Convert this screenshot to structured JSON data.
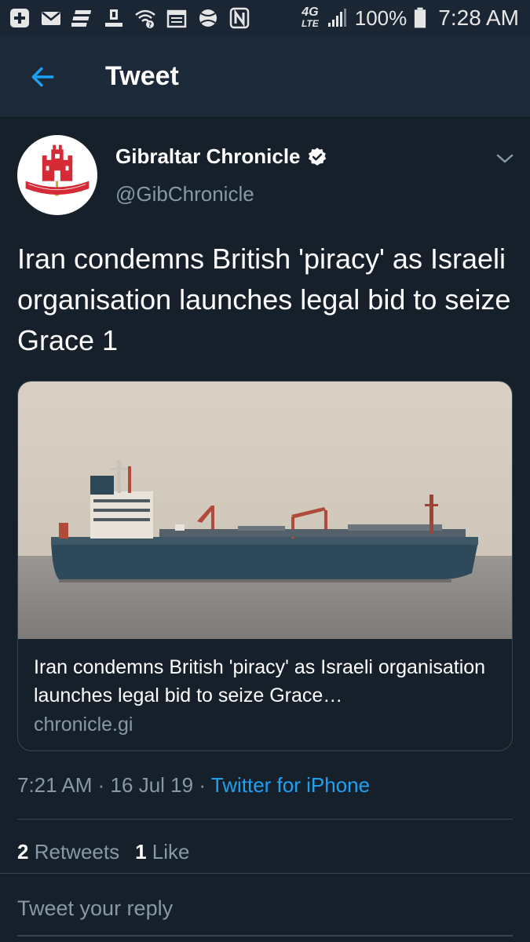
{
  "status_bar": {
    "network": "4G",
    "network_sub": "LTE",
    "battery": "100%",
    "time": "7:28 AM",
    "icons": [
      "plus-icon",
      "mail-icon",
      "layers-icon",
      "download-icon",
      "wifi-icon",
      "calendar-icon",
      "ball-icon",
      "nfc-icon",
      "signal-icon",
      "battery-icon"
    ]
  },
  "header": {
    "title": "Tweet",
    "back_icon": "arrow-left-icon"
  },
  "tweet": {
    "author": {
      "name": "Gibraltar Chronicle",
      "handle": "@GibChronicle",
      "verified": true,
      "avatar_text": "MONTIS INSIGNIA CALPE"
    },
    "text": "Iran condemns British 'piracy' as Israeli organisation launches legal bid to seize Grace 1",
    "card": {
      "title": "Iran condemns British 'piracy' as Israeli organisation launches legal bid to seize Grace…",
      "domain": "chronicle.gi"
    },
    "meta": {
      "time": "7:21 AM",
      "separator": "·",
      "date": "16 Jul 19",
      "source": "Twitter for iPhone"
    },
    "stats": {
      "retweets_count": "2",
      "retweets_label": "Retweets",
      "likes_count": "1",
      "likes_label": "Like"
    }
  },
  "reply": {
    "placeholder": "Tweet your reply"
  },
  "colors": {
    "background": "#15202b",
    "header": "#1c2938",
    "accent": "#1da1f2",
    "secondary_text": "#8899a6",
    "border": "#38444d"
  }
}
